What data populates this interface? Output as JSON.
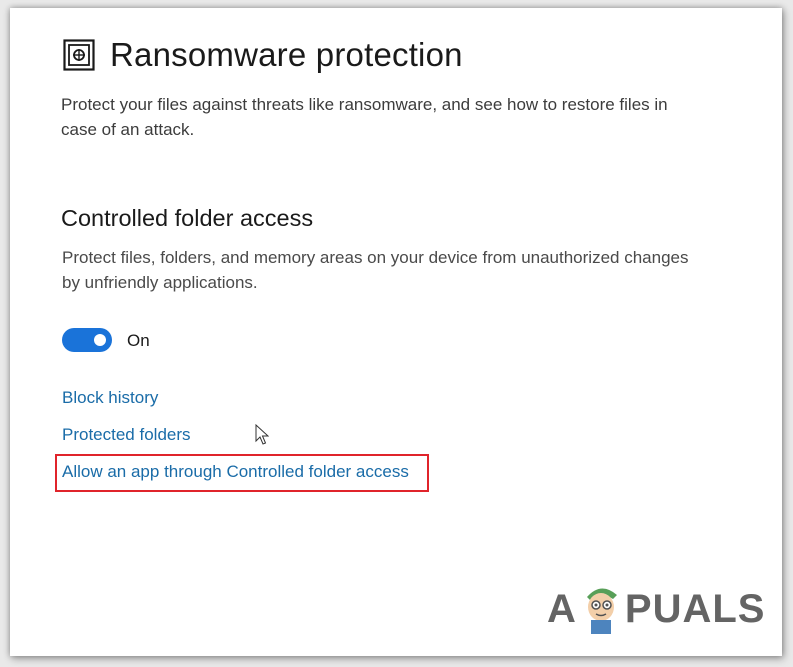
{
  "page": {
    "title": "Ransomware protection",
    "description": "Protect your files against threats like ransomware, and see how to restore files in case of an attack."
  },
  "section": {
    "title": "Controlled folder access",
    "description": "Protect files, folders, and memory areas on your device from unauthorized changes by unfriendly applications."
  },
  "toggle": {
    "state": "On",
    "accent_color": "#1a73d9"
  },
  "links": {
    "block_history": "Block history",
    "protected_folders": "Protected folders",
    "allow_app": "Allow an app through Controlled folder access"
  },
  "highlight_color": "#e0242b",
  "watermark": {
    "text_a": "A",
    "text_rest": "PUALS"
  },
  "icons": {
    "title": "ransomware-protection-icon",
    "cursor": "mouse-pointer-icon"
  }
}
